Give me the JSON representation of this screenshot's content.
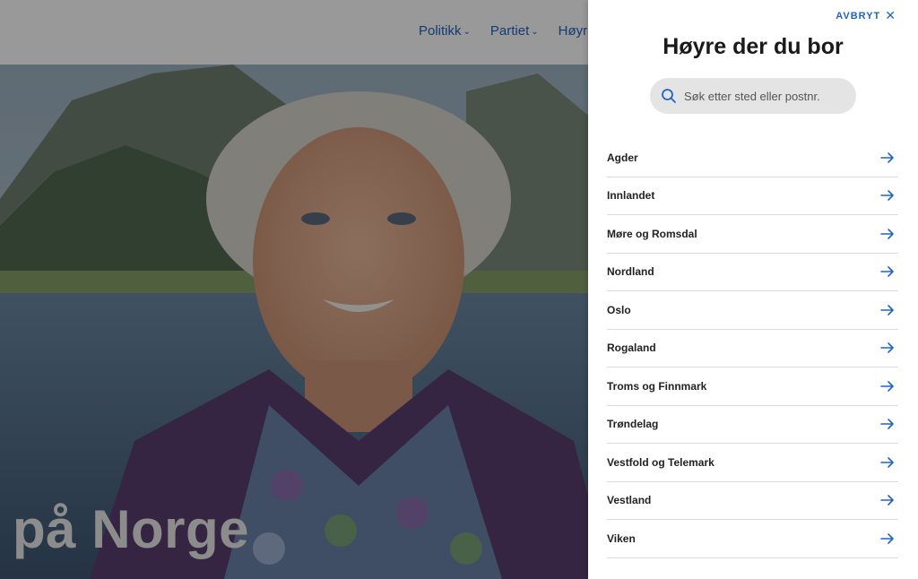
{
  "nav": {
    "items": [
      {
        "label": "Politikk"
      },
      {
        "label": "Partiet"
      },
      {
        "label": "Høyre"
      }
    ]
  },
  "hero": {
    "headline": "på Norge"
  },
  "panel": {
    "cancel_label": "AVBRYT",
    "title": "Høyre der du bor",
    "search_placeholder": "Søk etter sted eller postnr.",
    "regions": [
      {
        "label": "Agder"
      },
      {
        "label": "Innlandet"
      },
      {
        "label": "Møre og Romsdal"
      },
      {
        "label": "Nordland"
      },
      {
        "label": "Oslo"
      },
      {
        "label": "Rogaland"
      },
      {
        "label": "Troms og Finnmark"
      },
      {
        "label": "Trøndelag"
      },
      {
        "label": "Vestfold og Telemark"
      },
      {
        "label": "Vestland"
      },
      {
        "label": "Viken"
      }
    ]
  },
  "colors": {
    "accent": "#1f63c8",
    "panel_bg": "#ffffff",
    "search_bg": "#e4e4e4"
  }
}
